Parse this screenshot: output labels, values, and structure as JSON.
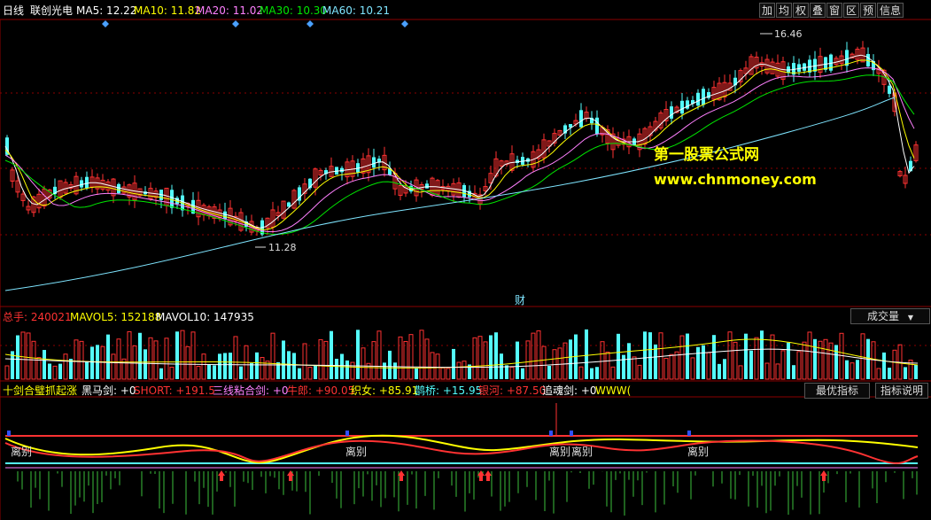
{
  "header": {
    "period": "日线",
    "stock": "联创光电",
    "ma5": "MA5: 12.22",
    "ma10": "MA10: 11.82",
    "ma20": "MA20: 11.02",
    "ma30": "MA30: 10.30",
    "ma60": "MA60: 10.21",
    "buttons": [
      "加",
      "均",
      "权",
      "叠",
      "窗",
      "区",
      "预",
      "信息"
    ]
  },
  "annotations": {
    "high": "16.46",
    "low": "11.28",
    "cai": "财"
  },
  "watermark": {
    "line1": "第一股票公式网",
    "line2": "www.chnmoney.com"
  },
  "volume": {
    "total": "总手: 240021",
    "mavol5": "MAVOL5: 152188",
    "mavol10": "MAVOL10: 147935",
    "dropdown": "成交量"
  },
  "indicator": {
    "name": "十剑合璧抓起涨",
    "heima": "黑马剑: +0",
    "short": "SHORT: +191.5",
    "sanxian": "三线粘合剑: +0",
    "niulang": "牛郎: +90.05",
    "zhinv": "织女: +85.91",
    "queqiao": "鹊桥: +15.95",
    "yinhe": "银河: +87.50",
    "zhuihun": "追魂剑: +0",
    "www": "WWW(",
    "best_btn": "最优指标",
    "help_btn": "指标说明",
    "parting": "离别"
  },
  "colors": {
    "up": "#ff3232",
    "down": "#54fcfc",
    "ma5": "#ffffff",
    "ma10": "#ffff00",
    "ma20": "#ff80ff",
    "ma30": "#00e600",
    "ma60": "#7fe5ff",
    "grid": "#8b0000"
  }
}
